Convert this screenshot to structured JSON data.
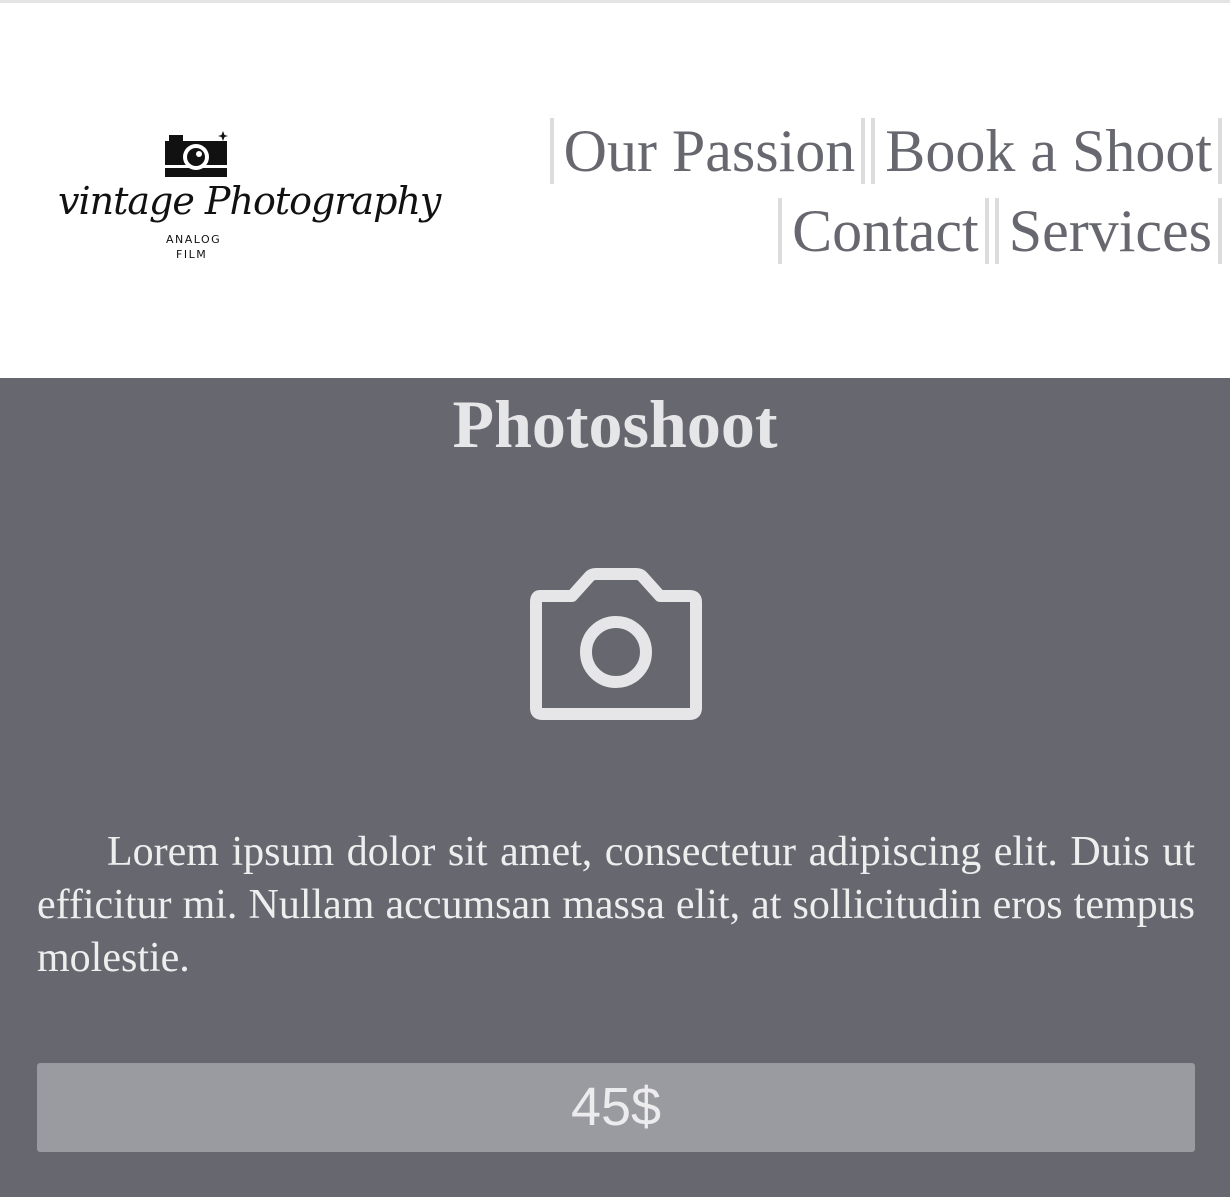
{
  "brand": {
    "logo_script": "vintage Photography",
    "logo_sub1": "ANALOG",
    "logo_sub2": "FILM"
  },
  "nav": {
    "items": [
      {
        "label": "Our Passion"
      },
      {
        "label": "Book a Shoot"
      },
      {
        "label": "Contact"
      },
      {
        "label": "Services"
      }
    ]
  },
  "service": {
    "title": "Photoshoot",
    "icon": "camera-icon",
    "description": "Lorem ipsum dolor sit amet, consectetur adipiscing elit. Duis ut efficitur mi. Nullam accumsan massa elit, at sollicitudin eros tempus molestie.",
    "price": "45$"
  },
  "colors": {
    "panel_bg": "#67676f",
    "button_bg": "#9a9aa1",
    "text_light": "#e6e6e8",
    "nav_text": "#67676f"
  }
}
